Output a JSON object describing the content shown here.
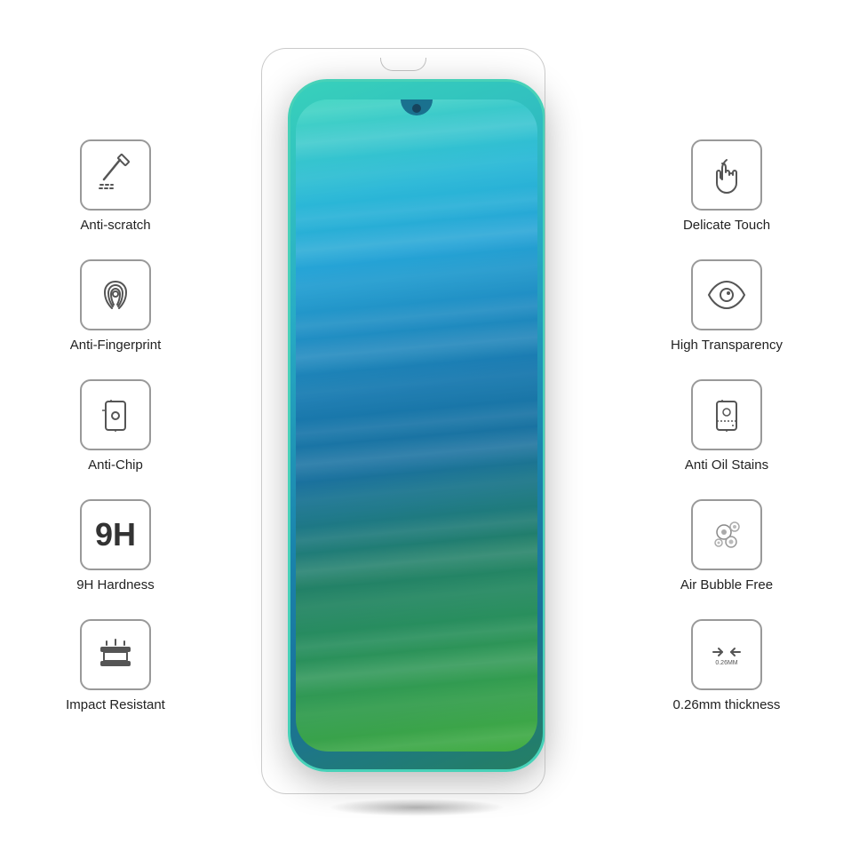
{
  "features": {
    "left": [
      {
        "id": "anti-scratch",
        "label": "Anti-scratch",
        "icon": "scratch"
      },
      {
        "id": "anti-fingerprint",
        "label": "Anti-Fingerprint",
        "icon": "fingerprint"
      },
      {
        "id": "anti-chip",
        "label": "Anti-Chip",
        "icon": "chip"
      },
      {
        "id": "9h-hardness",
        "label": "9H Hardness",
        "icon": "9h"
      },
      {
        "id": "impact-resistant",
        "label": "Impact Resistant",
        "icon": "impact"
      }
    ],
    "right": [
      {
        "id": "delicate-touch",
        "label": "Delicate Touch",
        "icon": "touch"
      },
      {
        "id": "high-transparency",
        "label": "High Transparency",
        "icon": "eye"
      },
      {
        "id": "anti-oil-stains",
        "label": "Anti Oil Stains",
        "icon": "oil"
      },
      {
        "id": "air-bubble-free",
        "label": "Air Bubble Free",
        "icon": "bubble"
      },
      {
        "id": "thickness",
        "label": "0.26mm thickness",
        "icon": "thickness"
      }
    ]
  }
}
